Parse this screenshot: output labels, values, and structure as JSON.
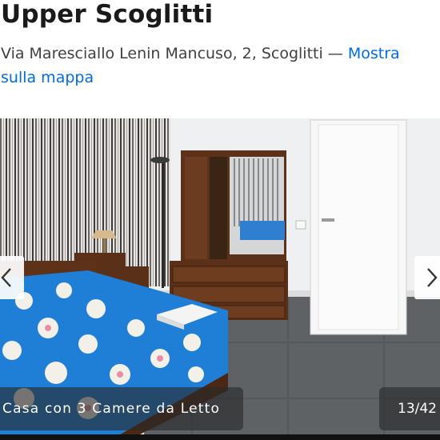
{
  "property": {
    "name": "Upper Scoglitti",
    "address": "Via Maresciallo Lenin Mancuso, 2, Scoglitti — ",
    "map_link": "Mostra sulla mappa"
  },
  "gallery": {
    "caption": "Casa con 3 Camere da Letto",
    "counter": "13/42",
    "prev_icon": "chevron-left-icon",
    "next_icon": "chevron-right-icon"
  }
}
